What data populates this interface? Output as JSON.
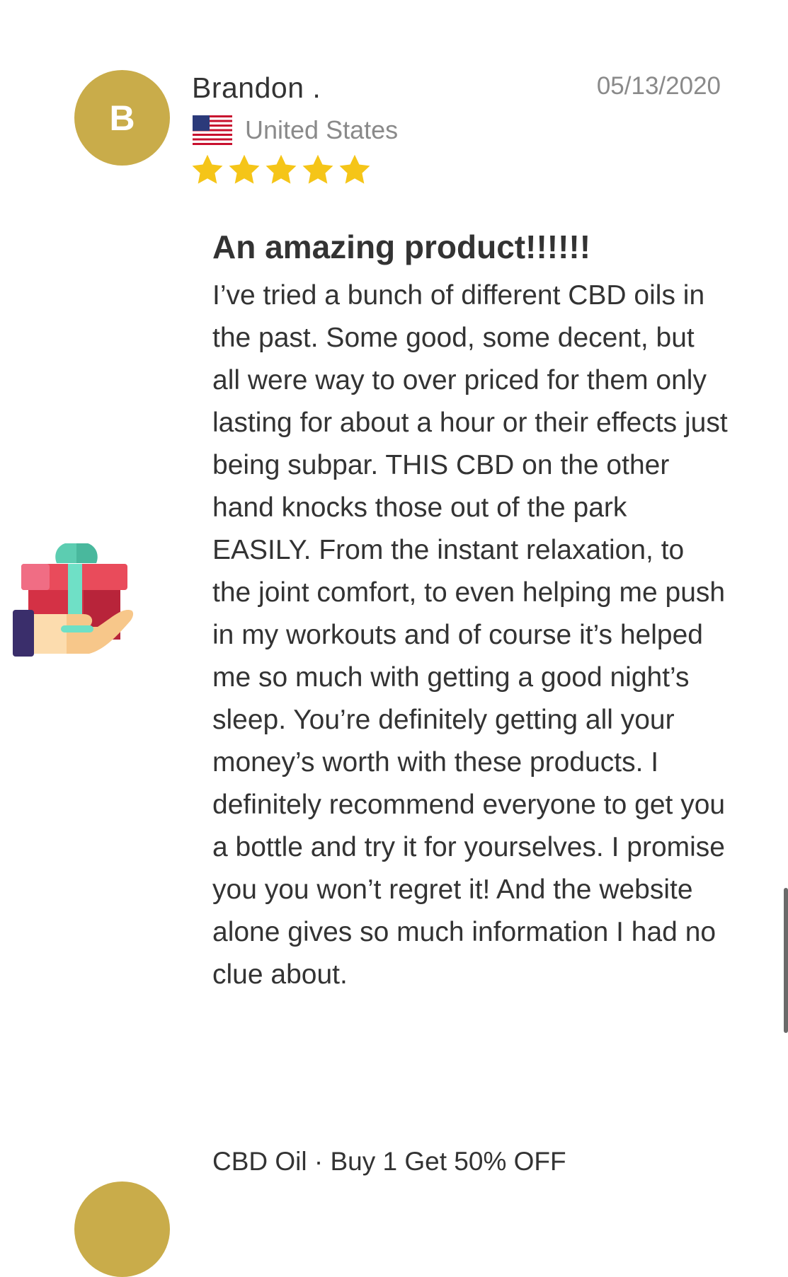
{
  "review": {
    "avatar_letter": "B",
    "reviewer_name": "Brandon .",
    "date": "05/13/2020",
    "country": "United States",
    "rating": 5,
    "title": "An amazing product!!!!!!",
    "body": "I’ve tried a bunch of different CBD oils in the past. Some good, some decent, but all were way to over priced for them only lasting for about a hour or their effects just being subpar. THIS CBD on the other hand knocks those out of the park EASILY. From the instant relaxation, to the joint comfort, to even helping me push in my workouts and of course it’s helped me so much with getting a good night’s sleep. You’re definitely getting all your money’s worth with these products. I definitely recommend everyone to get you a bottle and try it for yourselves. I promise you you won’t regret it! And the website alone gives so much information I had no clue about.",
    "product": "CBD Oil · Buy 1 Get 50% OFF"
  },
  "colors": {
    "avatar_bg": "#c9ac4a",
    "star": "#f5c518",
    "secondary_text": "#8a8a8a"
  },
  "icons": {
    "gift": "gift-in-hand-icon",
    "flag": "us-flag-icon",
    "star": "star-icon"
  }
}
